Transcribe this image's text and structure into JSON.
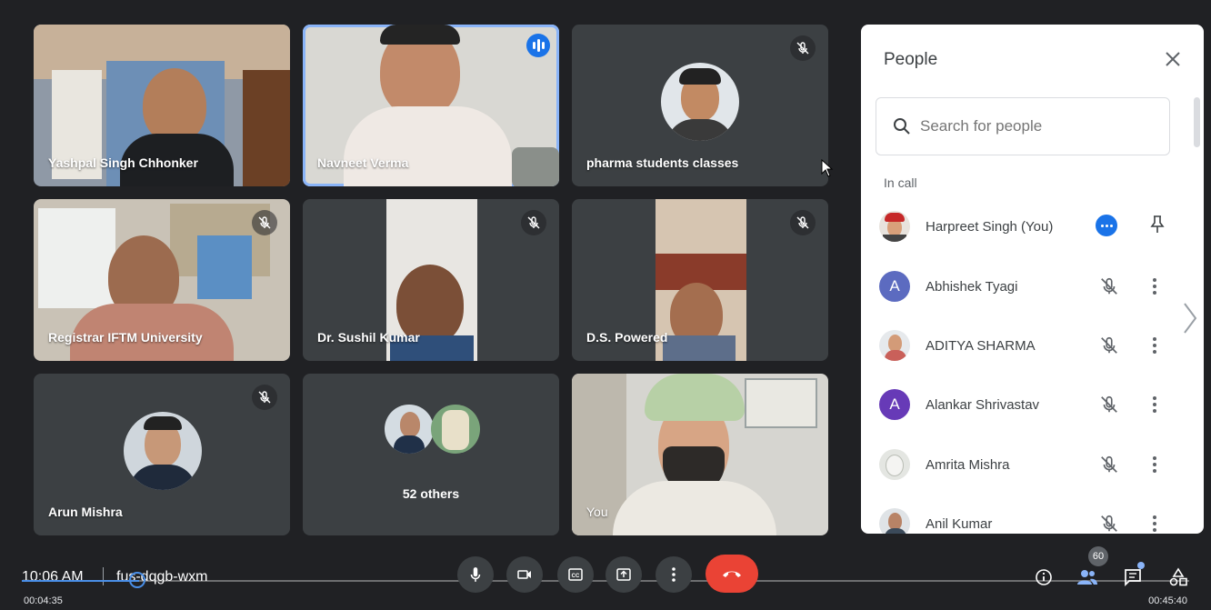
{
  "participants": [
    {
      "name": "Yashpal Singh Chhonker",
      "muted": false
    },
    {
      "name": "Navneet Verma",
      "speaking": true
    },
    {
      "name": "pharma students classes",
      "muted": true
    },
    {
      "name": "Registrar IFTM University",
      "muted": true
    },
    {
      "name": "Dr. Sushil Kumar",
      "muted": true
    },
    {
      "name": "D.S. Powered",
      "muted": true
    },
    {
      "name": "Arun Mishra",
      "muted": true
    },
    {
      "name": "52 others"
    },
    {
      "name": "You"
    }
  ],
  "people_panel": {
    "title": "People",
    "search_placeholder": "Search for people",
    "section_label": "In call",
    "people": [
      {
        "name": "Harpreet Singh (You)",
        "avatar": "photo"
      },
      {
        "name": "Abhishek Tyagi",
        "avatar_letter": "A",
        "avatar_color": "#5c6bc0"
      },
      {
        "name": "ADITYA SHARMA",
        "avatar": "photo"
      },
      {
        "name": "Alankar Shrivastav",
        "avatar_letter": "A",
        "avatar_color": "#673ab7"
      },
      {
        "name": "Amrita Mishra",
        "avatar": "photo"
      },
      {
        "name": "Anil Kumar",
        "avatar": "photo"
      }
    ]
  },
  "bottom_bar": {
    "time": "10:06 AM",
    "separator": "|",
    "meeting_code": "fus-dqgb-wxm",
    "participant_count": "60",
    "controls": [
      "mic-icon",
      "camera-icon",
      "captions-icon",
      "present-icon",
      "more-options-icon",
      "end-call-icon"
    ],
    "right_icons": [
      "info-icon",
      "people-icon",
      "chat-icon",
      "activities-icon"
    ]
  },
  "video_player": {
    "elapsed": "00:04:35",
    "duration": "00:45:40",
    "progress_fraction": 0.1004
  },
  "colors": {
    "accent": "#1a73e8",
    "end_call": "#ea4335",
    "tile_bg": "#3c4043",
    "page_bg": "#202124"
  }
}
